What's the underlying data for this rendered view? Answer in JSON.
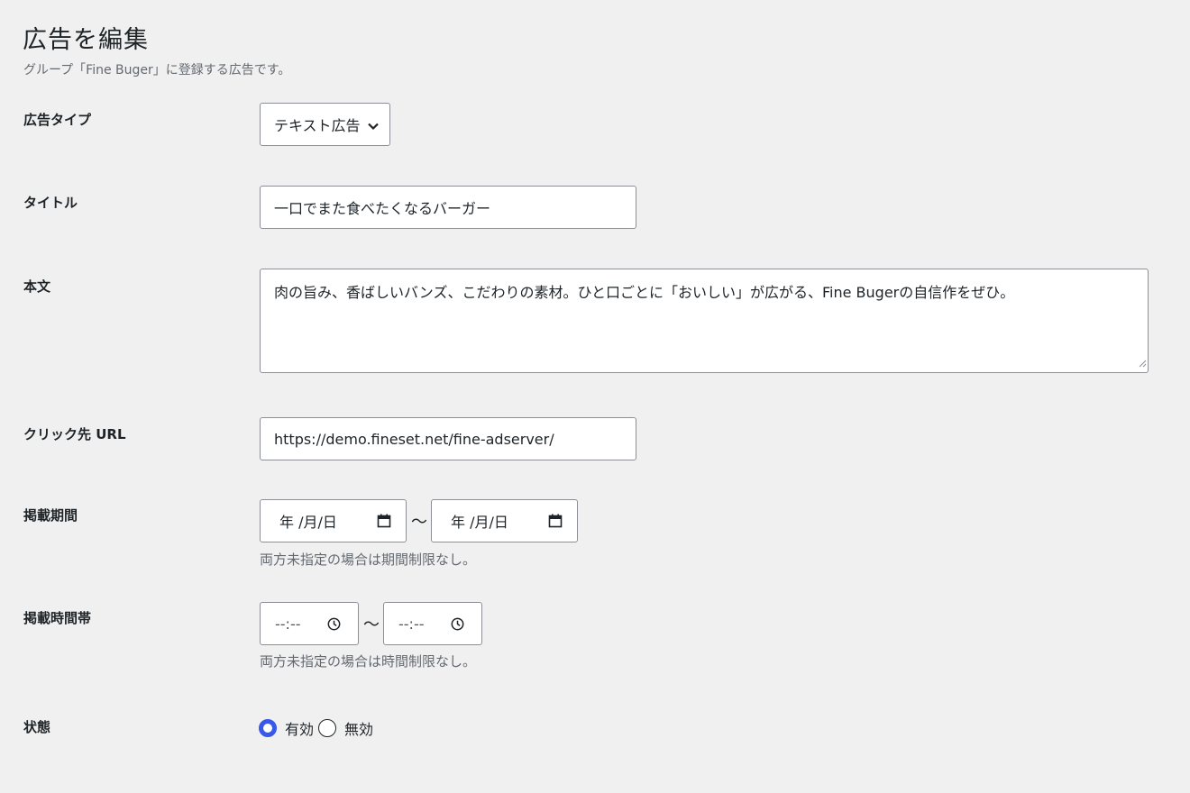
{
  "header": {
    "title": "広告を編集",
    "description": "グループ「Fine Buger」に登録する広告です。"
  },
  "form": {
    "ad_type": {
      "label": "広告タイプ",
      "value": "テキスト広告"
    },
    "title": {
      "label": "タイトル",
      "value": "一口でまた食べたくなるバーガー"
    },
    "body": {
      "label": "本文",
      "value": "肉の旨み、香ばしいバンズ、こだわりの素材。ひと口ごとに「おいしい」が広がる、Fine Bugerの自信作をぜひ。"
    },
    "click_url": {
      "label": "クリック先 URL",
      "value": "https://demo.fineset.net/fine-adserver/"
    },
    "period": {
      "label": "掲載期間",
      "start": "年 /月/日",
      "end": "年 /月/日",
      "separator": "〜",
      "hint": "両方未指定の場合は期間制限なし。"
    },
    "time_range": {
      "label": "掲載時間帯",
      "start": "--:--",
      "end": "--:--",
      "separator": "〜",
      "hint": "両方未指定の場合は時間制限なし。"
    },
    "status": {
      "label": "状態",
      "options": [
        "有効",
        "無効"
      ],
      "selected": "有効"
    }
  },
  "colors": {
    "accent": "#3858e9",
    "background": "#f0f0f0",
    "border": "#8c8f94",
    "muted_text": "#646970"
  },
  "icons": {
    "select": "chevron-down-icon",
    "date": "calendar-icon",
    "time": "clock-icon"
  }
}
